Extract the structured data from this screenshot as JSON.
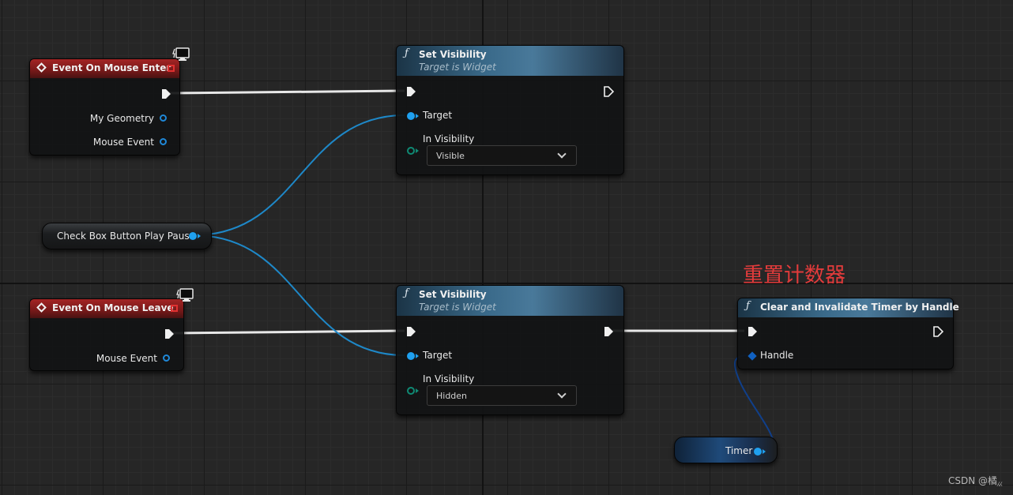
{
  "colors": {
    "grid_bg": "#262626",
    "event_header": "#a32424",
    "function_header": "#3a6a8a",
    "object_pin": "#1fa0ef",
    "struct_pin": "#0f8a74",
    "handle_pin": "#1060c0",
    "exec_wire": "#e8e8e8",
    "comment_text": "#e23b3b"
  },
  "node_enter": {
    "title": "Event On Mouse Enter",
    "icon": "event-diamond-icon",
    "pins": {
      "geometry": "My Geometry",
      "mouse_event": "Mouse Event"
    }
  },
  "node_leave": {
    "title": "Event On Mouse Leave",
    "icon": "event-diamond-icon",
    "pins": {
      "mouse_event": "Mouse Event"
    }
  },
  "node_setvis1": {
    "title": "Set Visibility",
    "subtitle": "Target is Widget",
    "icon": "function-icon",
    "target_label": "Target",
    "visibility_label": "In Visibility",
    "visibility_value": "Visible"
  },
  "node_setvis2": {
    "title": "Set Visibility",
    "subtitle": "Target is Widget",
    "icon": "function-icon",
    "target_label": "Target",
    "visibility_label": "In Visibility",
    "visibility_value": "Hidden"
  },
  "node_checkbox": {
    "label": "Check Box Button Play Pause"
  },
  "node_clear": {
    "title": "Clear and Invalidate Timer by Handle",
    "icon": "function-icon",
    "handle_label": "Handle"
  },
  "node_timer": {
    "label": "Timer"
  },
  "comment": {
    "text": "重置计数器"
  },
  "watermark": {
    "text": "CSDN @橘⁁⁁"
  }
}
